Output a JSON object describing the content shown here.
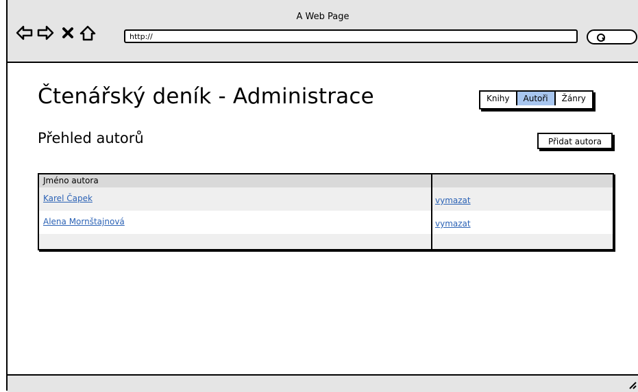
{
  "window": {
    "title": "A Web Page"
  },
  "toolbar": {
    "url": "http://",
    "icons": [
      "back-arrow-icon",
      "forward-arrow-icon",
      "close-x-icon",
      "home-icon",
      "search-icon"
    ]
  },
  "header": {
    "title": "Čtenářský deník - Administrace",
    "tabs": [
      {
        "label": "Knihy",
        "active": false
      },
      {
        "label": "Autoři",
        "active": true
      },
      {
        "label": "Žánry",
        "active": false
      }
    ]
  },
  "section": {
    "title": "Přehled autorů",
    "add_button": "Přidat autora"
  },
  "table": {
    "columns": [
      "Jméno autora",
      ""
    ],
    "rows": [
      {
        "name": "Karel Čapek",
        "action": "vymazat"
      },
      {
        "name": "Alena Mornštajnová",
        "action": "vymazat"
      }
    ]
  },
  "colors": {
    "active_tab": "#a8c6ef",
    "link": "#2b62b5",
    "chrome": "#e5e5e5"
  }
}
